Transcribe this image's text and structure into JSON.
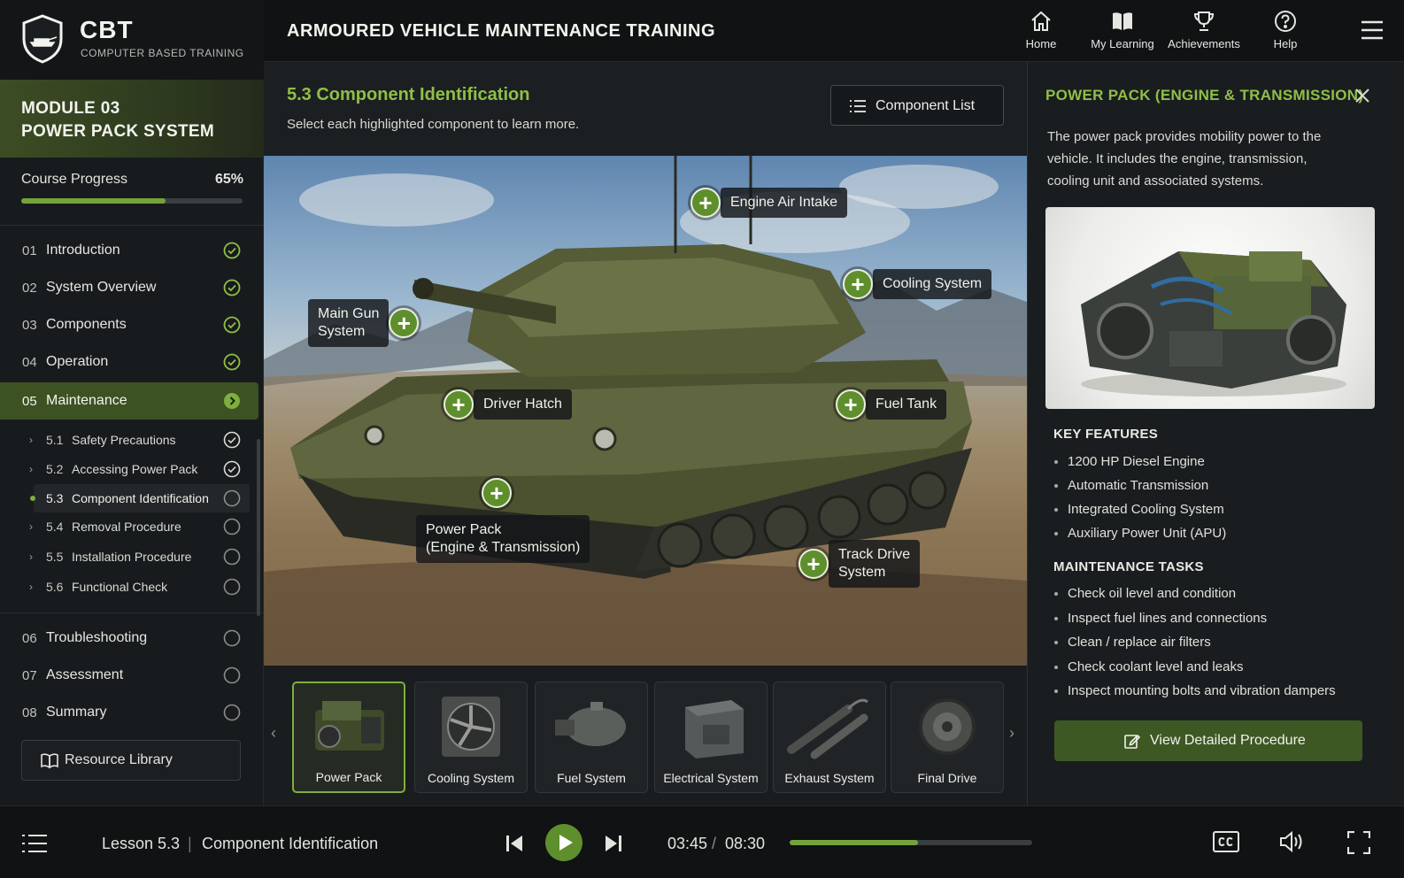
{
  "brand": {
    "title": "CBT",
    "subtitle": "COMPUTER BASED TRAINING"
  },
  "app_title": "ARMOURED VEHICLE MAINTENANCE TRAINING",
  "nav": [
    {
      "label": "Home",
      "icon": "home-icon"
    },
    {
      "label": "My Learning",
      "icon": "book-icon"
    },
    {
      "label": "Achievements",
      "icon": "trophy-icon"
    },
    {
      "label": "Help",
      "icon": "help-icon"
    }
  ],
  "module": {
    "line1": "MODULE 03",
    "line2": "POWER PACK SYSTEM"
  },
  "progress": {
    "label": "Course Progress",
    "percent_text": "65%",
    "value": 0.65
  },
  "menu": [
    {
      "num": "01",
      "label": "Introduction",
      "status": "complete"
    },
    {
      "num": "02",
      "label": "System Overview",
      "status": "complete"
    },
    {
      "num": "03",
      "label": "Components",
      "status": "complete"
    },
    {
      "num": "04",
      "label": "Operation",
      "status": "complete"
    },
    {
      "num": "05",
      "label": "Maintenance",
      "status": "active"
    },
    {
      "num": "06",
      "label": "Troubleshooting",
      "status": "incomplete"
    },
    {
      "num": "07",
      "label": "Assessment",
      "status": "incomplete"
    },
    {
      "num": "08",
      "label": "Summary",
      "status": "incomplete"
    }
  ],
  "submenu": [
    {
      "num": "5.1",
      "label": "Safety Precautions",
      "status": "complete"
    },
    {
      "num": "5.2",
      "label": "Accessing Power Pack",
      "status": "complete"
    },
    {
      "num": "5.3",
      "label": "Component Identification",
      "status": "current"
    },
    {
      "num": "5.4",
      "label": "Removal Procedure",
      "status": "incomplete"
    },
    {
      "num": "5.5",
      "label": "Installation Procedure",
      "status": "incomplete"
    },
    {
      "num": "5.6",
      "label": "Functional Check",
      "status": "incomplete"
    }
  ],
  "resource_library": "Resource Library",
  "section": {
    "title": "5.3 Component Identification",
    "subtitle": "Select each highlighted component to learn more.",
    "component_list_btn": "Component List"
  },
  "hotspots": [
    {
      "label": "Engine Air Intake"
    },
    {
      "label": "Cooling System"
    },
    {
      "label": "Main Gun\nSystem"
    },
    {
      "label": "Driver Hatch"
    },
    {
      "label": "Fuel Tank"
    },
    {
      "label": "Power Pack\n(Engine & Transmission)"
    },
    {
      "label": "Track Drive\nSystem"
    }
  ],
  "thumbnails": [
    {
      "label": "Power Pack",
      "selected": true
    },
    {
      "label": "Cooling System",
      "selected": false
    },
    {
      "label": "Fuel System",
      "selected": false
    },
    {
      "label": "Electrical System",
      "selected": false
    },
    {
      "label": "Exhaust System",
      "selected": false
    },
    {
      "label": "Final Drive",
      "selected": false
    }
  ],
  "panel": {
    "title": "POWER PACK (ENGINE & TRANSMISSION)",
    "description": "The power pack provides mobility power to the vehicle. It includes the engine, transmission, cooling unit and associated systems.",
    "key_features_heading": "KEY FEATURES",
    "key_features": [
      "1200 HP Diesel Engine",
      "Automatic Transmission",
      "Integrated Cooling System",
      "Auxiliary Power Unit (APU)"
    ],
    "tasks_heading": "MAINTENANCE TASKS",
    "tasks": [
      "Check oil level and condition",
      "Inspect fuel lines and connections",
      "Clean / replace air filters",
      "Check coolant level and leaks",
      "Inspect mounting bolts and vibration dampers"
    ],
    "procedure_btn": "View Detailed Procedure"
  },
  "player": {
    "lesson": "Lesson 5.3",
    "separator": "|",
    "lesson_name": "Component Identification",
    "current_time": "03:45",
    "time_separator": "/",
    "total_time": "08:30",
    "progress": 0.53
  },
  "colors": {
    "accent": "#74a339",
    "accent_text": "#8fbf47",
    "active_bg": "#3d5222",
    "panel_bg": "#1a1d1f"
  }
}
